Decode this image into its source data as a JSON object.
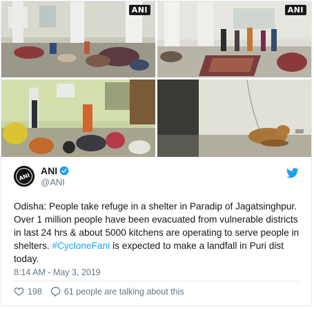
{
  "media": {
    "photos": [
      {
        "watermark": "ANI"
      },
      {
        "watermark": "ANI"
      },
      {
        "watermark": ""
      },
      {
        "watermark": ""
      }
    ]
  },
  "author": {
    "display_name": "ANI",
    "handle": "@ANI",
    "verified": true,
    "avatar_text": "ANI"
  },
  "tweet": {
    "text_before_hashtag": "Odisha: People take refuge in a shelter in Paradip of Jagatsinghpur. Over 1 million people have been evacuated from vulnerable districts in last 24 hrs & about 5000 kitchens are operating to serve people in shelters. ",
    "hashtag": "#CycloneFani",
    "text_after_hashtag": " is expected to make a landfall in Puri dist today.",
    "timestamp": "8:14 AM - May 3, 2019"
  },
  "actions": {
    "like_count": "198",
    "conversation_label": "61 people are talking about this"
  },
  "colors": {
    "accent": "#1da1f2",
    "secondary_text": "#657786",
    "like_icon": "#657786"
  },
  "icons": {
    "verified": "verified-badge-icon",
    "brand": "twitter-bird-icon",
    "like": "heart-icon",
    "conversation": "speech-bubble-icon"
  }
}
